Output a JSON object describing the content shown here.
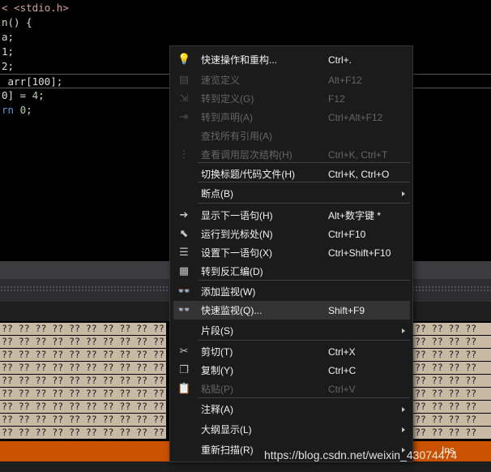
{
  "editor": {
    "lines": [
      {
        "parts": [
          {
            "t": "< ",
            "c": "pp"
          },
          {
            "t": "<stdio.h>",
            "c": "pp"
          }
        ]
      },
      {
        "parts": [
          {
            "t": "n",
            "c": "fn"
          },
          {
            "t": "() {",
            "c": ""
          }
        ]
      },
      {
        "parts": [
          {
            "t": "a;",
            "c": ""
          }
        ]
      },
      {
        "parts": [
          {
            "t": "1;",
            "c": ""
          }
        ]
      },
      {
        "parts": [
          {
            "t": "2;",
            "c": ""
          }
        ]
      },
      {
        "parts": [
          {
            "t": " arr[100];",
            "c": ""
          }
        ]
      },
      {
        "parts": [
          {
            "t": "0] = ",
            "c": ""
          },
          {
            "t": "4",
            "c": "num"
          },
          {
            "t": ";",
            "c": ""
          }
        ]
      },
      {
        "parts": [
          {
            "t": "rn ",
            "c": "kw"
          },
          {
            "t": "0",
            "c": "num"
          },
          {
            "t": ";",
            "c": ""
          }
        ]
      }
    ]
  },
  "memory": {
    "left_cells": "?? ?? ?? ?? ?? ?? ?? ?? ?? ??",
    "right_cells": "?? ?? ?? ??",
    "row_count": 9
  },
  "status_bar": {
    "mode": "Ins"
  },
  "context_menu": {
    "items": [
      {
        "label": "快速操作和重构...",
        "shortcut": "Ctrl+.",
        "icon": "lightbulb-icon",
        "glyph": "💡",
        "disabled": false
      },
      {
        "label": "速览定义",
        "shortcut": "Alt+F12",
        "icon": "peek-definition-icon",
        "glyph": "▤",
        "disabled": true
      },
      {
        "label": "转到定义(G)",
        "shortcut": "F12",
        "icon": "go-to-definition-icon",
        "glyph": "⇲",
        "disabled": true
      },
      {
        "label": "转到声明(A)",
        "shortcut": "Ctrl+Alt+F12",
        "icon": "go-to-declaration-icon",
        "glyph": "⇥",
        "disabled": true
      },
      {
        "label": "查找所有引用(A)",
        "shortcut": "",
        "icon": "",
        "glyph": "",
        "disabled": true
      },
      {
        "label": "查看调用层次结构(H)",
        "shortcut": "Ctrl+K, Ctrl+T",
        "icon": "call-hierarchy-icon",
        "glyph": "⋮",
        "disabled": true
      },
      {
        "label": "切换标题/代码文件(H)",
        "shortcut": "Ctrl+K, Ctrl+O",
        "icon": "",
        "glyph": "",
        "disabled": false
      },
      {
        "label": "断点(B)",
        "shortcut": "",
        "icon": "",
        "glyph": "",
        "disabled": false,
        "submenu": true
      },
      {
        "label": "显示下一语句(H)",
        "shortcut": "Alt+数字键 *",
        "icon": "arrow-right-icon",
        "glyph": "➔",
        "disabled": false
      },
      {
        "label": "运行到光标处(N)",
        "shortcut": "Ctrl+F10",
        "icon": "cursor-icon",
        "glyph": "⬉",
        "disabled": false
      },
      {
        "label": "设置下一语句(X)",
        "shortcut": "Ctrl+Shift+F10",
        "icon": "set-next-statement-icon",
        "glyph": "☰",
        "disabled": false
      },
      {
        "label": "转到反汇编(D)",
        "shortcut": "",
        "icon": "disassembly-icon",
        "glyph": "▦",
        "disabled": false
      },
      {
        "label": "添加监视(W)",
        "shortcut": "",
        "icon": "glasses-icon",
        "glyph": "👓",
        "disabled": false
      },
      {
        "label": "快速监视(Q)...",
        "shortcut": "Shift+F9",
        "icon": "glasses-icon",
        "glyph": "👓",
        "disabled": false,
        "hover": true
      },
      {
        "label": "片段(S)",
        "shortcut": "",
        "icon": "",
        "glyph": "",
        "disabled": false,
        "submenu": true
      },
      {
        "label": "剪切(T)",
        "shortcut": "Ctrl+X",
        "icon": "scissors-icon",
        "glyph": "✂",
        "disabled": false
      },
      {
        "label": "复制(Y)",
        "shortcut": "Ctrl+C",
        "icon": "copy-icon",
        "glyph": "❐",
        "disabled": false
      },
      {
        "label": "粘贴(P)",
        "shortcut": "Ctrl+V",
        "icon": "paste-icon",
        "glyph": "📋",
        "disabled": true
      },
      {
        "label": "注释(A)",
        "shortcut": "",
        "icon": "",
        "glyph": "",
        "disabled": false,
        "submenu": true
      },
      {
        "label": "大纲显示(L)",
        "shortcut": "",
        "icon": "",
        "glyph": "",
        "disabled": false,
        "submenu": true
      },
      {
        "label": "重新扫描(R)",
        "shortcut": "",
        "icon": "",
        "glyph": "",
        "disabled": false,
        "submenu": true
      }
    ]
  },
  "watermark": "https://blog.csdn.net/weixin_43074474"
}
